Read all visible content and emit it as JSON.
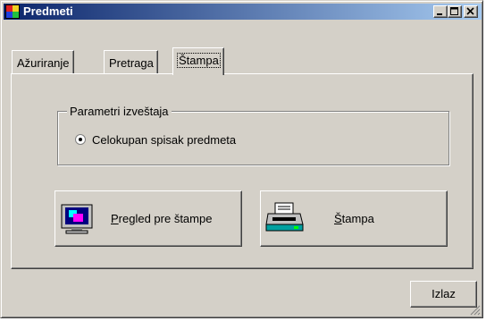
{
  "window": {
    "title": "Predmeti",
    "title_bar_color": "#0a246a",
    "face_color": "#d4d0c8",
    "controls": [
      {
        "name": "minimize",
        "icon": "minimize-icon"
      },
      {
        "name": "maximize",
        "icon": "maximize-icon"
      },
      {
        "name": "close",
        "icon": "close-icon"
      }
    ]
  },
  "tabs": [
    {
      "label": "Ažuriranje",
      "active": false
    },
    {
      "label": "Pretraga",
      "active": false
    },
    {
      "label": "Štampa",
      "active": true
    }
  ],
  "report_params": {
    "group_label": "Parametri izveštaja",
    "option_label": "Celokupan spisak predmeta",
    "option_selected": true
  },
  "buttons": {
    "preview": {
      "label": "Pregled pre štampe",
      "icon": "monitor-icon"
    },
    "print": {
      "label": "Štampa",
      "icon": "printer-icon"
    },
    "exit": {
      "label": "Izlaz"
    }
  }
}
